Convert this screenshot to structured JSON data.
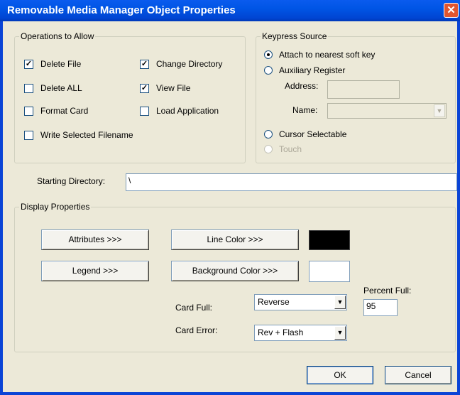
{
  "window": {
    "title": "Removable Media Manager Object Properties",
    "close_glyph": "✕"
  },
  "operations": {
    "legend": "Operations to Allow",
    "items": [
      {
        "label": "Delete File",
        "checked": true
      },
      {
        "label": "Change Directory",
        "checked": true
      },
      {
        "label": "Delete ALL",
        "checked": false
      },
      {
        "label": "View File",
        "checked": true
      },
      {
        "label": "Format Card",
        "checked": false
      },
      {
        "label": "Load Application",
        "checked": false
      },
      {
        "label": "Write Selected Filename",
        "checked": false
      }
    ]
  },
  "keypress": {
    "legend": "Keypress Source",
    "attach_label": "Attach to nearest soft key",
    "auxiliary_label": "Auxiliary Register",
    "address_label": "Address:",
    "name_label": "Name:",
    "cursor_label": "Cursor Selectable",
    "touch_label": "Touch",
    "selected": "attach"
  },
  "starting_directory": {
    "label": "Starting Directory:",
    "value": "\\"
  },
  "display": {
    "legend": "Display Properties",
    "attributes_button": "Attributes >>>",
    "legend_button": "Legend >>>",
    "line_color_button": "Line Color >>>",
    "background_color_button": "Background Color >>>",
    "line_color": "#000000",
    "background_color": "#ffffff",
    "card_full_label": "Card Full:",
    "card_full_value": "Reverse",
    "card_error_label": "Card Error:",
    "card_error_value": "Rev + Flash",
    "percent_full_label": "Percent Full:",
    "percent_full_value": "95",
    "dropdown_arrow": "▼"
  },
  "footer": {
    "ok": "OK",
    "cancel": "Cancel"
  },
  "check_glyph": "✓"
}
